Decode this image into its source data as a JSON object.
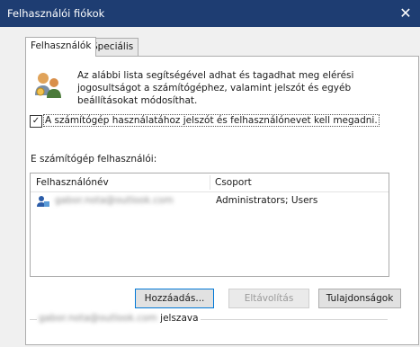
{
  "window": {
    "title": "Felhasználói fiókok",
    "close_glyph": "✕"
  },
  "tabs": [
    {
      "label": "Felhasználók",
      "active": true
    },
    {
      "label": "Speciális",
      "active": false
    }
  ],
  "intro_text": "Az alábbi lista segítségével adhat és tagadhat meg elérési jogosultságot a számítógéphez, valamint jelszót és egyéb beállításokat módosíthat.",
  "require_password": {
    "checked": true,
    "label": "A számítógép használatához jelszót és felhasználónevet kell megadni."
  },
  "users_section_label": "E számítógép felhasználói:",
  "table": {
    "columns": [
      "Felhasználónév",
      "Csoport"
    ],
    "rows": [
      {
        "username": "gabor.nota@outlook.com",
        "group": "Administrators; Users",
        "icon": "user-icon"
      }
    ]
  },
  "buttons": {
    "add": "Hozzáadás...",
    "remove": "Eltávolítás",
    "properties": "Tulajdonságok"
  },
  "password_group": {
    "user": "gabor.nota@outlook.com",
    "suffix": "jelszava"
  },
  "colors": {
    "titlebar": "#1e3d72",
    "focus_border": "#0078d7"
  }
}
